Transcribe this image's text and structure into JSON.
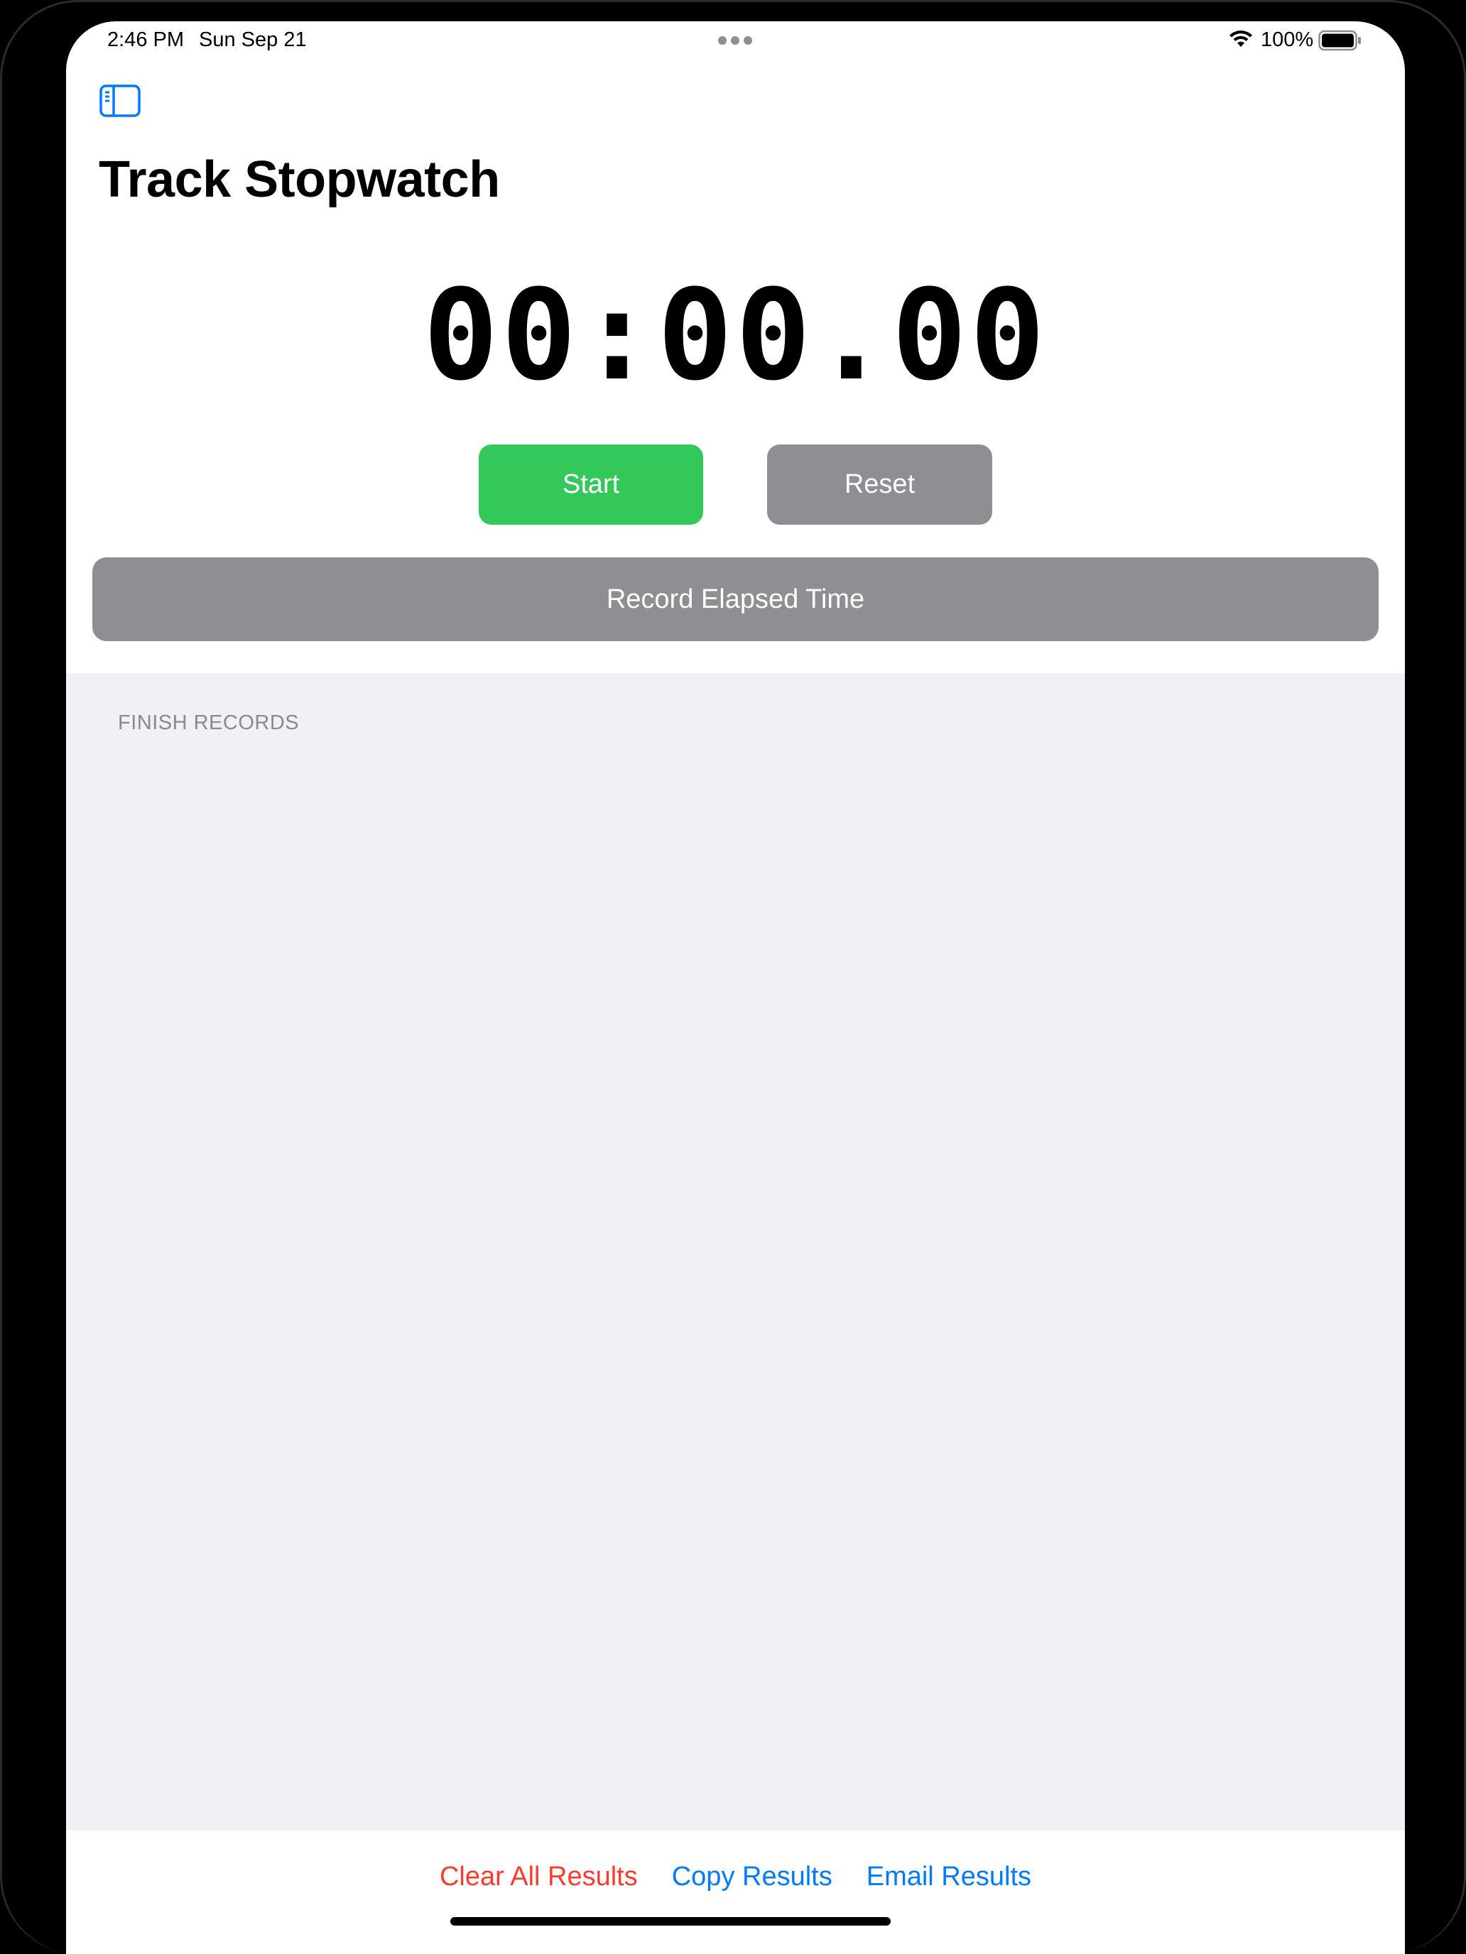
{
  "status_bar": {
    "time": "2:46 PM",
    "date": "Sun Sep 21",
    "battery": "100%"
  },
  "header": {
    "title": "Track Stopwatch"
  },
  "stopwatch": {
    "elapsed": "00:00.00"
  },
  "controls": {
    "start_label": "Start",
    "reset_label": "Reset",
    "record_label": "Record Elapsed Time"
  },
  "records": {
    "section_header": "FINISH RECORDS",
    "items": []
  },
  "footer": {
    "clear_label": "Clear All Results",
    "copy_label": "Copy Results",
    "email_label": "Email Results"
  },
  "colors": {
    "accent": "#007aff",
    "start_green": "#34c759",
    "neutral_gray": "#8e8e93",
    "destructive_red": "#ff3b30",
    "grouped_background": "#f0f0f5"
  },
  "icons": {
    "sidebar_toggle": "sidebar-left-icon",
    "wifi": "wifi-icon",
    "battery": "battery-full-icon"
  }
}
